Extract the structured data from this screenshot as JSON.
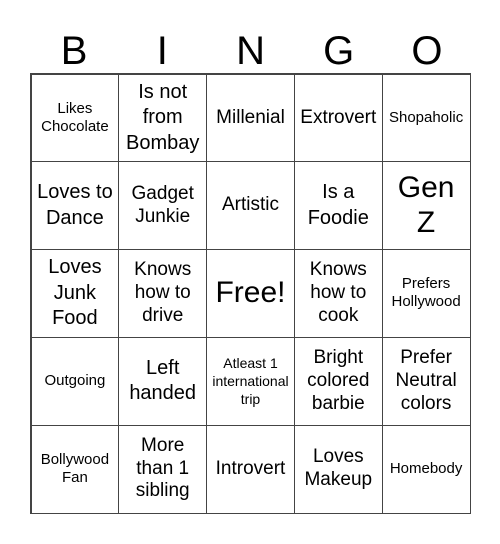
{
  "header": [
    "B",
    "I",
    "N",
    "G",
    "O"
  ],
  "cells": [
    "Likes Chocolate",
    "Is not from Bombay",
    "Millenial",
    "Extrovert",
    "Shopaholic",
    "Loves to Dance",
    "Gadget Junkie",
    "Artistic",
    "Is a Foodie",
    "Gen Z",
    "Loves Junk Food",
    "Knows how to drive",
    "Free!",
    "Knows how to cook",
    "Prefers Hollywood",
    "Outgoing",
    "Left handed",
    "Atleast 1 international trip",
    "Bright colored barbie",
    "Prefer Neutral colors",
    "Bollywood Fan",
    "More than 1 sibling",
    "Introvert",
    "Loves Makeup",
    "Homebody"
  ]
}
